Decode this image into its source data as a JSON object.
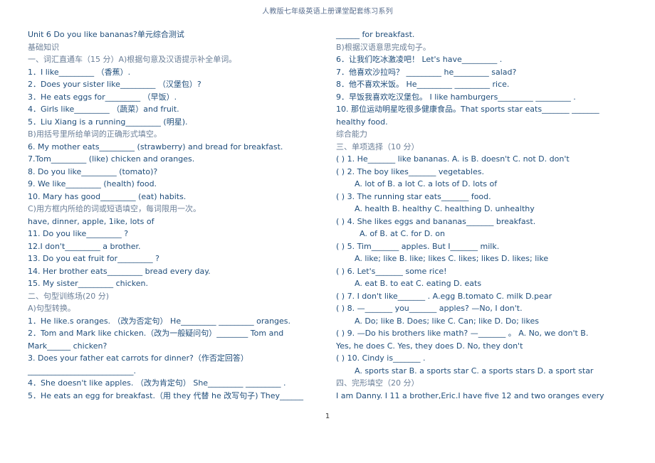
{
  "header": {
    "title": "人教版七年级英语上册课堂配套练习系列"
  },
  "left_column": [
    {
      "text": "Unit 6 Do you like bananas?单元综合测试",
      "kind": "title"
    },
    {
      "text": "基础知识",
      "kind": "cn"
    },
    {
      "text": "一、词汇直通车（15 分）A)根据句意及汉语提示补全单词。",
      "kind": "cn"
    },
    {
      "text": "1．I like_________ （香蕉）.",
      "kind": "q"
    },
    {
      "text": "2．Does your sister like_________ （汉堡包）?",
      "kind": "q"
    },
    {
      "text": "3．He eats eggs for_________ （早饭）.",
      "kind": "q"
    },
    {
      "text": "4．Girls like_________ （蔬菜）and fruit.",
      "kind": "q"
    },
    {
      "text": "5．Liu Xiang is a running_________ (明星).",
      "kind": "q"
    },
    {
      "text": "B)用括号里所给单词的正确形式填空。",
      "kind": "cn"
    },
    {
      "text": "6. My mother eats_________ (strawberry) and bread for breakfast.",
      "kind": "q"
    },
    {
      "text": "7.Tom_________ (like) chicken and oranges.",
      "kind": "q"
    },
    {
      "text": "8. Do you like_________ (tomato)?",
      "kind": "q"
    },
    {
      "text": "9. We like_________ (health) food.",
      "kind": "q"
    },
    {
      "text": "10. Mary has good_________ (eat) habits.",
      "kind": "q"
    },
    {
      "text": "C)用方框内所给的词或短语填空，每词限用一次。",
      "kind": "cn"
    },
    {
      "text": "have,   dinner,   apple,  1ike,   lots of",
      "kind": "q"
    },
    {
      "text": "11. Do you like_________ ?",
      "kind": "q"
    },
    {
      "text": "12.I don't_________ a brother.",
      "kind": "q"
    },
    {
      "text": "13. Do you eat fruit for_________ ?",
      "kind": "q"
    },
    {
      "text": "14. Her brother eats_________ bread every day.",
      "kind": "q"
    },
    {
      "text": "15. My sister_________ chicken.",
      "kind": "q"
    },
    {
      "text": "二、句型训练场(20 分)",
      "kind": "cn"
    },
    {
      "text": "A)句型转换。",
      "kind": "cn"
    },
    {
      "text": "1．He like.s oranges. （改为否定句）   He_________ _________ oranges.",
      "kind": "q"
    },
    {
      "text": "2．Tom and Mark like chicken.（改为一般疑问句）________ Tom and",
      "kind": "q"
    },
    {
      "text": "Mark______ chicken?",
      "kind": "q"
    },
    {
      "text": "3. Does your father eat carrots for dinner?（作否定回答）",
      "kind": "q"
    },
    {
      "text": "___________________________.",
      "kind": "q"
    },
    {
      "text": "4．She doesn't like apples. （改为肯定句）   She_________ _________ .",
      "kind": "q"
    },
    {
      "text": "5．He eats an egg for breakfast.（用 they 代替 he 改写句子) They______",
      "kind": "q"
    }
  ],
  "right_column": [
    {
      "text": "______ for breakfast.",
      "kind": "q"
    },
    {
      "text": "B)根据汉语意思完成句子。",
      "kind": "cn"
    },
    {
      "text": "6．让我们吃冰激凌吧！   Let's have_________ .",
      "kind": "q"
    },
    {
      "text": "7．他喜欢沙拉吗？    _________ he_________ salad?",
      "kind": "q"
    },
    {
      "text": "8．他不喜欢米饭。   He_________ _________ rice.",
      "kind": "q"
    },
    {
      "text": "9．早饭我喜欢吃汉堡包。  I like hamburgers_________ _________ .",
      "kind": "q"
    },
    {
      "text": "10. 那位运动明星吃很多健康食品。That sports star eats_______ _______",
      "kind": "q"
    },
    {
      "text": "healthy food.",
      "kind": "q"
    },
    {
      "text": "综合能力",
      "kind": "cn"
    },
    {
      "text": "三、单项选择（10 分）",
      "kind": "cn"
    },
    {
      "text": "(   ) 1. He_______ like bananas.    A. is     B. doesn't    C. not     D. don't",
      "kind": "q"
    },
    {
      "text": "(   ) 2. The boy likes_______ vegetables.",
      "kind": "q"
    },
    {
      "text": "A. lot of      B. a lot       C. a lots of       D. lots of",
      "kind": "opt"
    },
    {
      "text": "(   ) 3. The running star eats_______ food.",
      "kind": "q"
    },
    {
      "text": "A. health       B. healthy     C. healthing      D. unhealthy",
      "kind": "opt"
    },
    {
      "text": "(   ) 4. She likes eggs and bananas_______ breakfast.",
      "kind": "q"
    },
    {
      "text": "A. of          B. at   C. for    D. on",
      "kind": "opt2"
    },
    {
      "text": "(   ) 5. Tim_______ apples. But I_______ milk.",
      "kind": "q"
    },
    {
      "text": "A. like; like     B. like; likes     C. likes; likes     D. likes; like",
      "kind": "opt"
    },
    {
      "text": "(   ) 6. Let's_______ some rice!",
      "kind": "q"
    },
    {
      "text": "A. eat       B. to eat      C. eating       D. eats",
      "kind": "opt"
    },
    {
      "text": "(   ) 7. I don't like_______ .       A.egg     B.tomato     C. milk     D.pear",
      "kind": "q"
    },
    {
      "text": "(   ) 8. —_______ you_______ apples?     —No, I don't.",
      "kind": "q"
    },
    {
      "text": "A. Do; like      B. Does; like      C. Can; like      D. Do; likes",
      "kind": "opt"
    },
    {
      "text": "(   ) 9. —Do his brothers like math?   —_______  。      A. No, we don't   B.",
      "kind": "q"
    },
    {
      "text": "Yes, he does   C. Yes, they does   D. No, they don't",
      "kind": "q"
    },
    {
      "text": "(   ) 10. Cindy is_______ .",
      "kind": "q"
    },
    {
      "text": "A. sports star    B. a sports star    C. a sports stars    D. a sport star",
      "kind": "opt"
    },
    {
      "text": "四、完形填空（20 分）",
      "kind": "cn"
    },
    {
      "text": "  I am Danny. I  11  a brother,Eric.I have five  12  and two oranges every",
      "kind": "q"
    }
  ],
  "footer": {
    "page_number": "1"
  }
}
